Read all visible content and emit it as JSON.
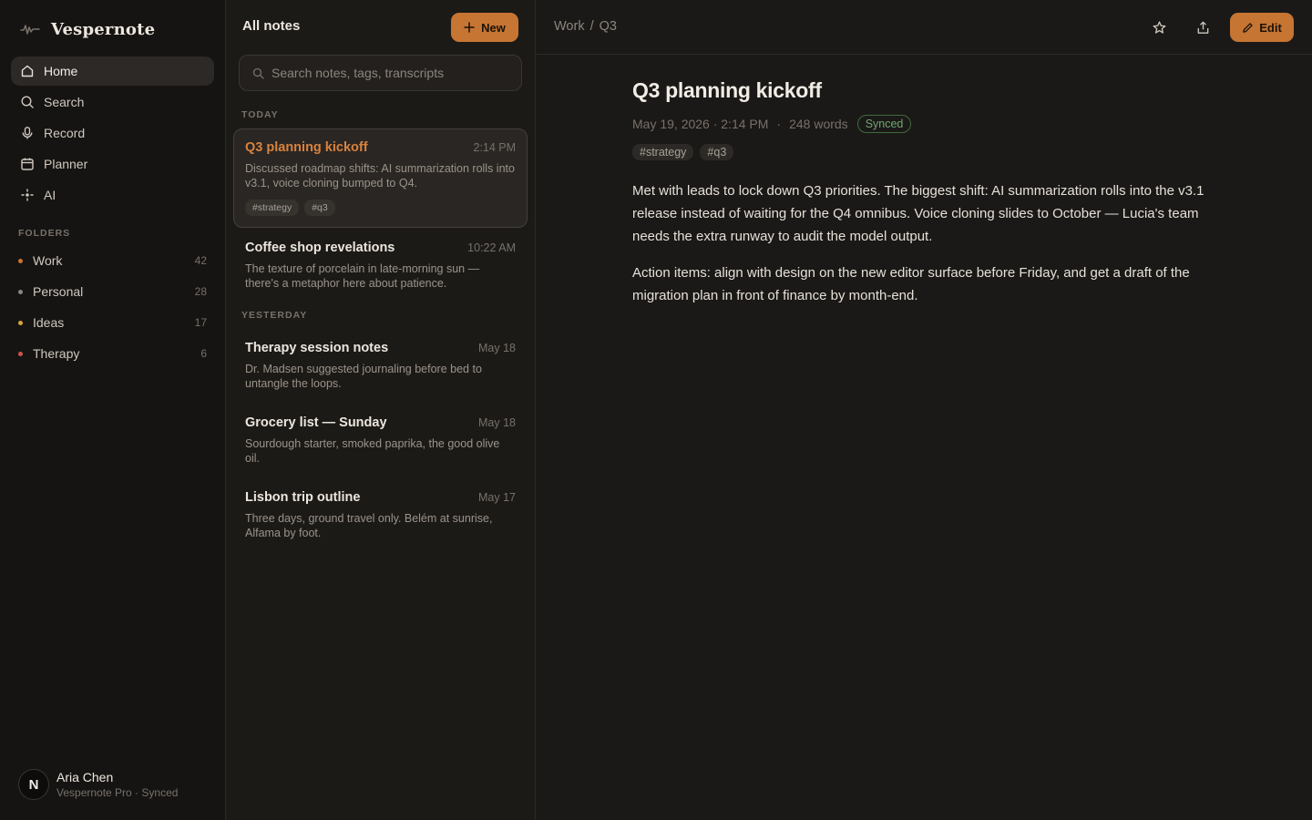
{
  "app": {
    "name": "Vespernote"
  },
  "sidebar": {
    "nav": [
      {
        "label": "Home",
        "icon": "home-icon",
        "active": true
      },
      {
        "label": "Search",
        "icon": "search-icon"
      },
      {
        "label": "Record",
        "icon": "microphone-icon"
      },
      {
        "label": "Planner",
        "icon": "calendar-icon"
      },
      {
        "label": "AI",
        "icon": "sparkle-icon"
      }
    ],
    "folders_label": "FOLDERS",
    "folders": [
      {
        "name": "Work",
        "count": "42",
        "color": "#c77533"
      },
      {
        "name": "Personal",
        "count": "28",
        "color": "#8a8680"
      },
      {
        "name": "Ideas",
        "count": "17",
        "color": "#d9a441"
      },
      {
        "name": "Therapy",
        "count": "6",
        "color": "#c9564a"
      }
    ],
    "user": {
      "initial": "N",
      "name": "Aria Chen",
      "subtitle": "Vespernote Pro · Synced"
    }
  },
  "list": {
    "title": "All notes",
    "new_label": "New",
    "search_placeholder": "Search notes, tags, transcripts",
    "groups": {
      "today": "TODAY",
      "yesterday": "YESTERDAY"
    },
    "notes": [
      {
        "title": "Q3 planning kickoff",
        "time": "2:14 PM",
        "snippet": "Discussed roadmap shifts: AI summarization rolls into v3.1, voice cloning bumped to Q4.",
        "tags": [
          "#strategy",
          "#q3"
        ],
        "active": true
      },
      {
        "title": "Coffee shop revelations",
        "time": "10:22 AM",
        "snippet": "The texture of porcelain in late-morning sun — there's a metaphor here about patience."
      },
      {
        "title": "Therapy session notes",
        "time": "May 18",
        "snippet": "Dr. Madsen suggested journaling before bed to untangle the loops."
      },
      {
        "title": "Grocery list — Sunday",
        "time": "May 18",
        "snippet": "Sourdough starter, smoked paprika, the good olive oil."
      },
      {
        "title": "Lisbon trip outline",
        "time": "May 17",
        "snippet": "Three days, ground travel only. Belém at sunrise, Alfama by foot."
      }
    ]
  },
  "main": {
    "breadcrumb": [
      "Work",
      "/",
      "Q3"
    ],
    "edit_label": "Edit",
    "doc": {
      "title": "Q3 planning kickoff",
      "date": "May 19, 2026 · 2:14 PM",
      "sep": "·",
      "words": "248 words",
      "status": "Synced",
      "tags": [
        "#strategy",
        "#q3"
      ],
      "paragraphs": [
        "Met with leads to lock down Q3 priorities. The biggest shift: AI summarization rolls into the v3.1 release instead of waiting for the Q4 omnibus. Voice cloning slides to October — Lucia's team needs the extra runway to audit the model output.",
        "Action items: align with design on the new editor surface before Friday, and get a draft of the migration plan in front of finance by month-end."
      ]
    }
  },
  "colors": {
    "accent": "#c77533",
    "background": "#1a1816",
    "synced": "#6fa86f"
  }
}
